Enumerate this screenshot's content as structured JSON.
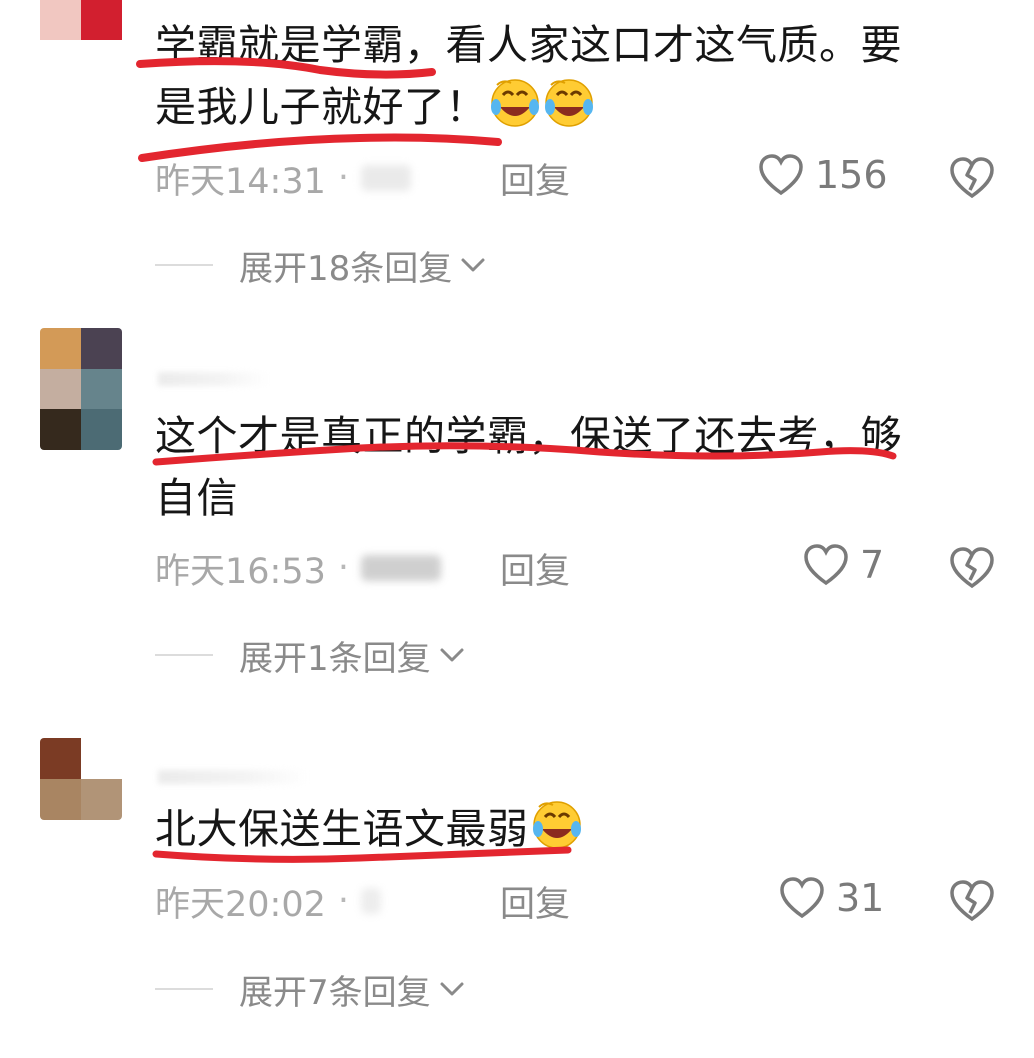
{
  "comments": [
    {
      "text_line1": "学霸就是学霸，看人家这口才这气质。要",
      "text_line2": "是我儿子就好了！",
      "time": "昨天14:31",
      "separator": "·",
      "reply_label": "回复",
      "like_count": "156",
      "expand_label": "展开18条回复",
      "emoji": "laughing-crying-emoji x2"
    },
    {
      "text_line1": "这个才是真正的学霸，保送了还去考，够",
      "text_line2": "自信",
      "time": "昨天16:53",
      "separator": "·",
      "reply_label": "回复",
      "like_count": "7",
      "expand_label": "展开1条回复"
    },
    {
      "text_line1": "北大保送生语文最弱",
      "time": "昨天20:02",
      "separator": "·",
      "reply_label": "回复",
      "like_count": "31",
      "expand_label": "展开7条回复",
      "emoji": "laughing-crying-emoji"
    }
  ],
  "colors": {
    "underline": "#e3262f",
    "meta": "#a8a8a8",
    "icon": "#7a7a7a",
    "text": "#161616"
  },
  "icons": {
    "like": "heart-outline-icon",
    "dislike": "broken-heart-icon",
    "expand": "chevron-down-icon"
  }
}
